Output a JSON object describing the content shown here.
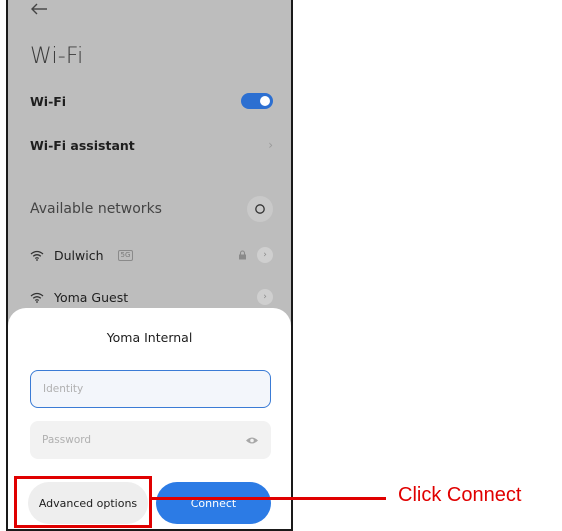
{
  "screen": {
    "title": "Wi-Fi"
  },
  "wifi_toggle": {
    "label": "Wi-Fi",
    "enabled": true
  },
  "assistant": {
    "label": "Wi-Fi assistant"
  },
  "networks": {
    "section_label": "Available networks",
    "items": [
      {
        "name": "Dulwich",
        "band": "5G",
        "locked": true
      },
      {
        "name": "Yoma Guest",
        "band": "",
        "locked": false
      }
    ]
  },
  "dialog": {
    "title": "Yoma Internal",
    "identity_placeholder": "Identity",
    "password_placeholder": "Password",
    "advanced_label": "Advanced options",
    "connect_label": "Connect"
  },
  "annotation": {
    "callout_text": "Click Connect",
    "color": "#e00000"
  },
  "colors": {
    "accent": "#2c7be5",
    "toggle": "#2c6fd1",
    "background": "#bdbdbd"
  }
}
